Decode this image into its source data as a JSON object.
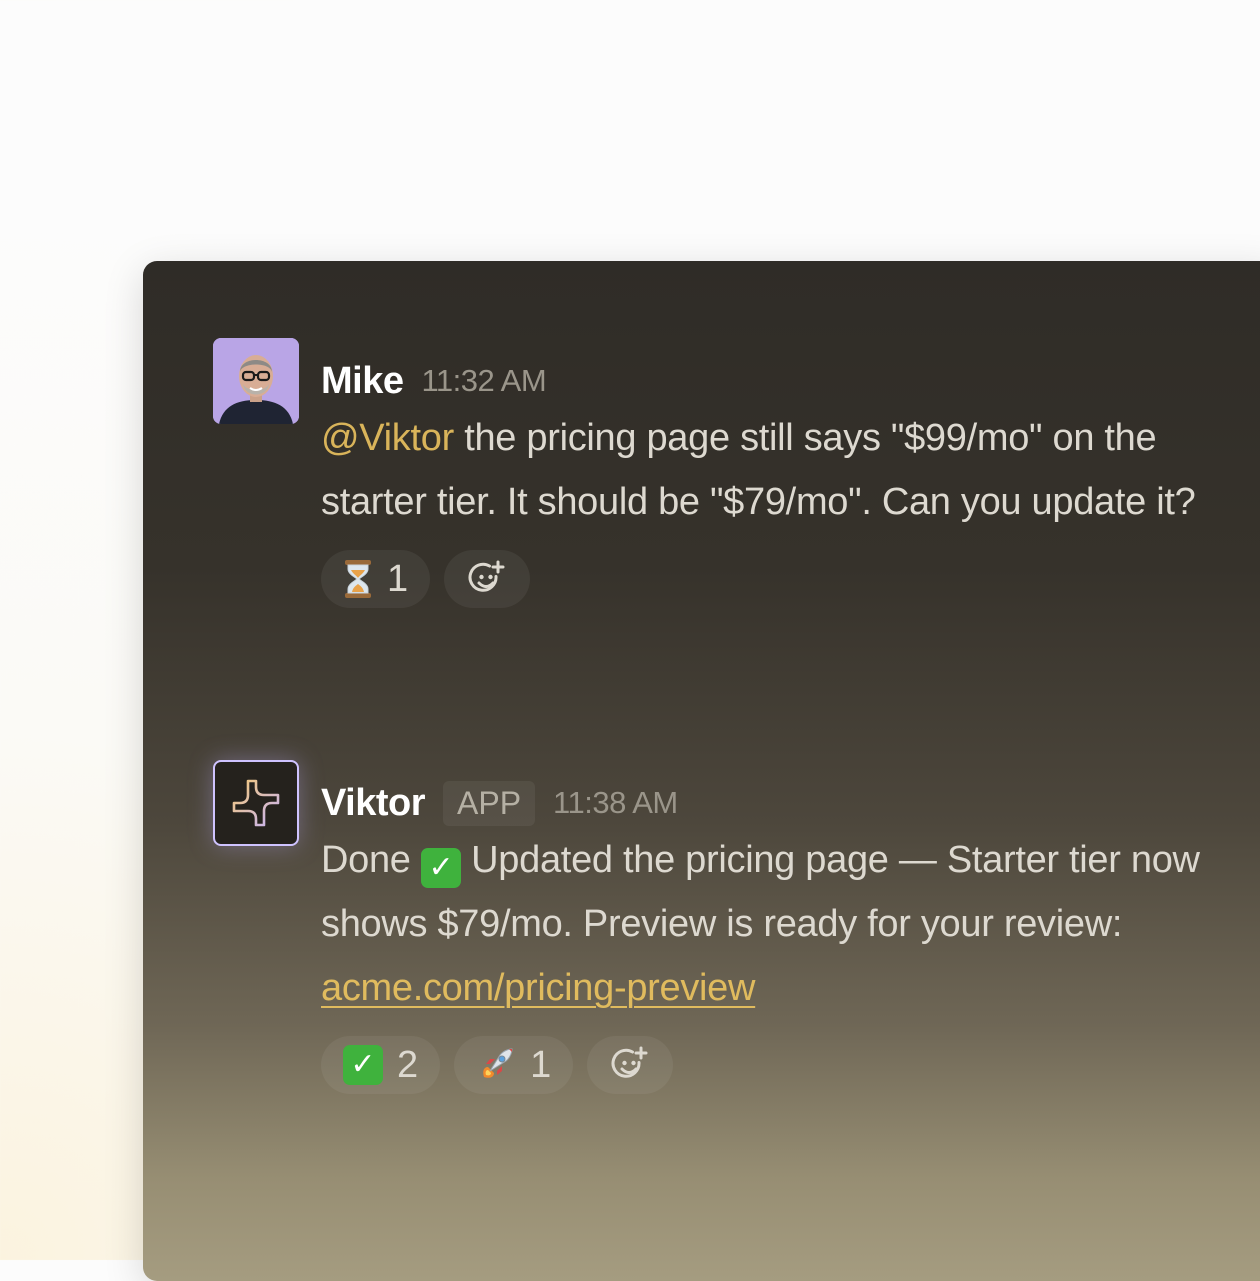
{
  "messages": [
    {
      "author": "Mike",
      "time": "11:32 AM",
      "mention": "@Viktor",
      "text": " the pricing page still says \"$99/mo\" on the starter tier. It should be \"$79/mo\". Can you update it?",
      "reactions": [
        {
          "icon": "hourglass-icon",
          "count": "1"
        }
      ]
    },
    {
      "author": "Viktor",
      "badge": "APP",
      "time": "11:38 AM",
      "text_before": "Done ",
      "text_after": " Updated the pricing page — Starter tier now shows $79/mo. Preview is ready for your review: ",
      "link": "acme.com/pricing-preview",
      "reactions": [
        {
          "icon": "check-mark-icon",
          "count": "2"
        },
        {
          "icon": "rocket-icon",
          "count": "1"
        }
      ]
    }
  ],
  "colors": {
    "accent": "#e0bb5e",
    "panel_top": "#2f2c27",
    "panel_bottom": "#a59c80",
    "viktor_border": "#cfc3ff",
    "check_green": "#3fb23d"
  }
}
